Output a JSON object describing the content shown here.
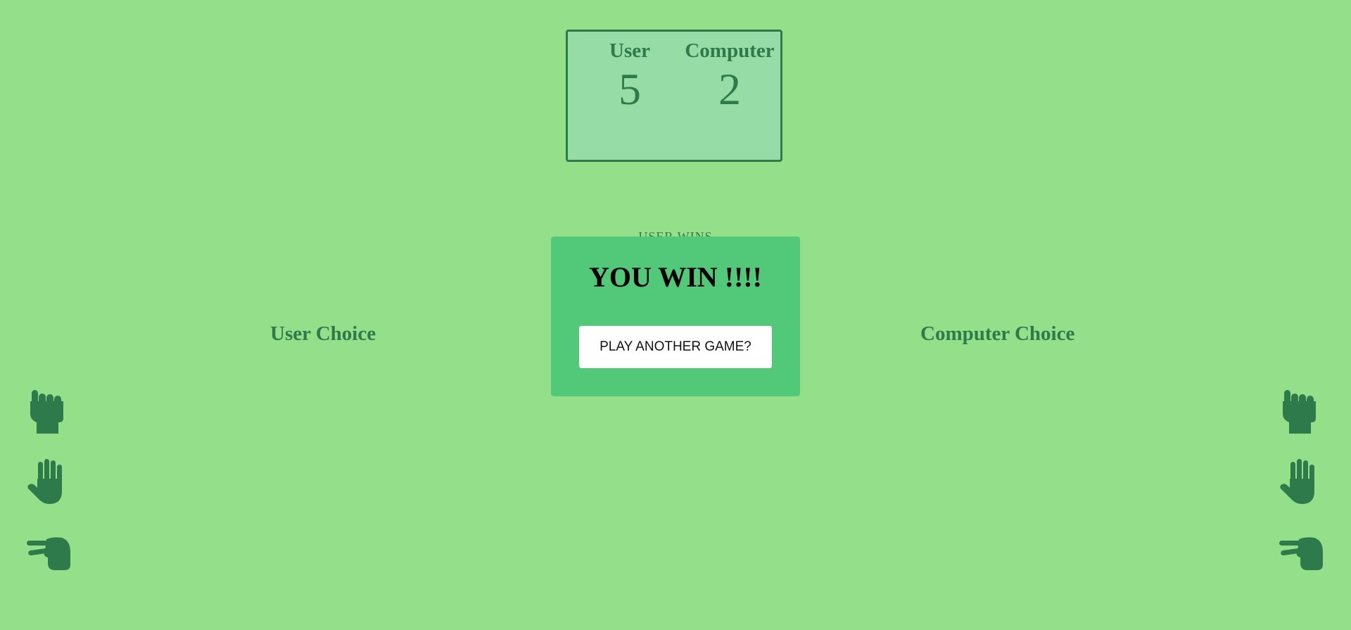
{
  "scoreboard": {
    "user_label": "User",
    "computer_label": "Computer",
    "user_score": "5",
    "computer_score": "2"
  },
  "round_message": "USER WINS",
  "choices": {
    "user_heading": "User Choice",
    "computer_heading": "Computer Choice",
    "options": [
      "rock",
      "paper",
      "scissors"
    ]
  },
  "popup": {
    "title": "YOU WIN !!!!",
    "button_label": "PLAY ANOTHER GAME?"
  },
  "colors": {
    "background": "#94df8a",
    "accent": "#2f7a4a",
    "popup": "#52c978",
    "scoreboard": "#95dca7"
  }
}
